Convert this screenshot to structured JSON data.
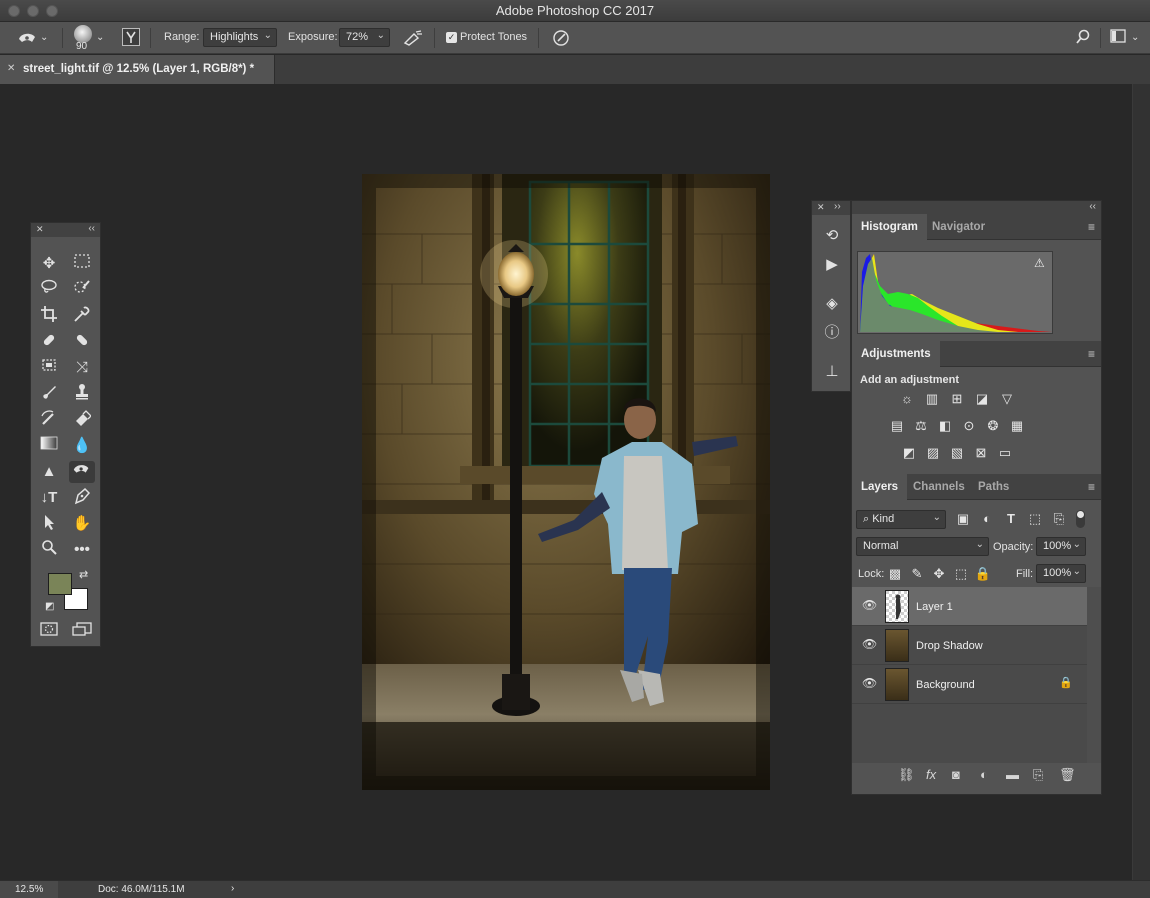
{
  "window": {
    "title": "Adobe Photoshop CC 2017"
  },
  "options": {
    "brush_size": "90",
    "range_label": "Range:",
    "range_value": "Highlights",
    "exposure_label": "Exposure:",
    "exposure_value": "72%",
    "protect_tones_label": "Protect Tones",
    "protect_tones_checked": true
  },
  "document": {
    "tab_title": "street_light.tif @ 12.5% (Layer 1, RGB/8*) *"
  },
  "panels": {
    "histogram_tabs": [
      "Histogram",
      "Navigator"
    ],
    "adjustments_title": "Adjustments",
    "add_adjustment": "Add an adjustment",
    "layers_tabs": [
      "Layers",
      "Channels",
      "Paths"
    ],
    "filter_kind": "Kind",
    "blend_mode": "Normal",
    "opacity_label": "Opacity:",
    "opacity_value": "100%",
    "lock_label": "Lock:",
    "fill_label": "Fill:",
    "fill_value": "100%",
    "layers": [
      {
        "name": "Layer 1",
        "selected": true,
        "locked": false
      },
      {
        "name": "Drop Shadow",
        "selected": false,
        "locked": false
      },
      {
        "name": "Background",
        "selected": false,
        "locked": true
      }
    ]
  },
  "colors": {
    "foreground": "#7a8458",
    "background": "#ffffff"
  },
  "status": {
    "zoom": "12.5%",
    "doc": "Doc: 46.0M/115.1M"
  }
}
